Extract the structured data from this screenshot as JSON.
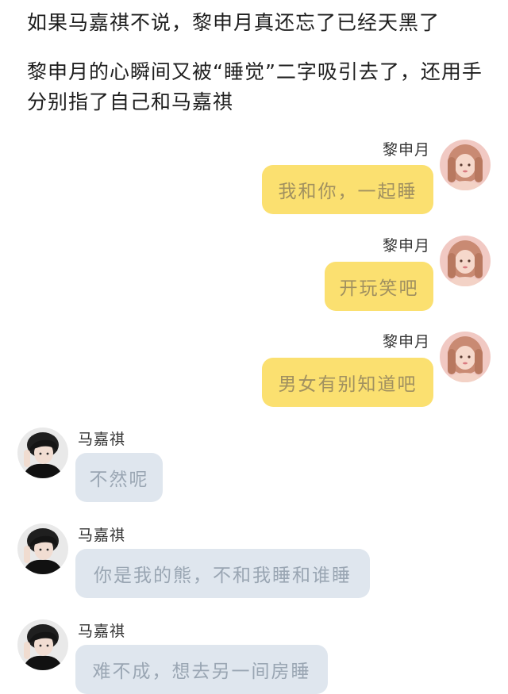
{
  "narration": {
    "line1": "如果马嘉祺不说，黎申月真还忘了已经天黑了",
    "line2": "黎申月的心瞬间又被“睡觉”二字吸引去了，还用手分别指了自己和马嘉祺"
  },
  "chat": {
    "messages": [
      {
        "sender": "黎申月",
        "text": "我和你，一起睡"
      },
      {
        "sender": "黎申月",
        "text": "开玩笑吧"
      },
      {
        "sender": "黎申月",
        "text": "男女有别知道吧"
      },
      {
        "sender": "马嘉祺",
        "text": "不然呢"
      },
      {
        "sender": "马嘉祺",
        "text": "你是我的熊，不和我睡和谁睡"
      },
      {
        "sender": "马嘉祺",
        "text": "难不成，想去另一间房睡"
      }
    ]
  },
  "colors": {
    "right_bubble": "#fbe070",
    "left_bubble": "#dfe6ee"
  },
  "icons": {
    "right_avatar": "girl-avatar",
    "left_avatar": "boy-avatar"
  }
}
